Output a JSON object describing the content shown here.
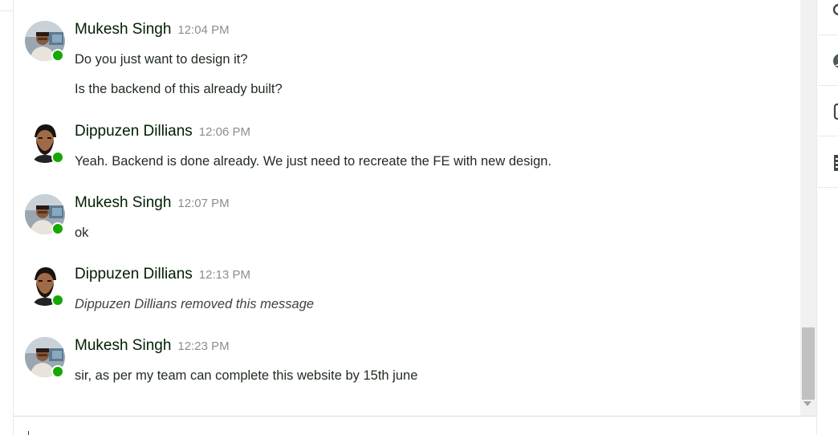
{
  "messages": [
    {
      "sender": "Mukesh Singh",
      "time": "12:04 PM",
      "avatar": "mukesh",
      "online": true,
      "lines": [
        "Do you just want to design it?",
        "Is the backend of this already built?"
      ]
    },
    {
      "sender": "Dippuzen Dillians",
      "time": "12:06 PM",
      "avatar": "dippuzen",
      "online": true,
      "lines": [
        "Yeah. Backend is done already. We just need to recreate the FE with new design."
      ]
    },
    {
      "sender": "Mukesh Singh",
      "time": "12:07 PM",
      "avatar": "mukesh",
      "online": true,
      "lines": [
        "ok"
      ]
    },
    {
      "sender": "Dippuzen Dillians",
      "time": "12:13 PM",
      "avatar": "dippuzen",
      "online": true,
      "lines": [
        "Dippuzen Dillians removed this message"
      ],
      "removed": true
    },
    {
      "sender": "Mukesh Singh",
      "time": "12:23 PM",
      "avatar": "mukesh",
      "online": true,
      "lines": [
        "sir, as per my team can complete this website by 15th june"
      ]
    }
  ],
  "right_rail": {
    "icons": [
      "search-icon",
      "profile-icon",
      "attachment-icon",
      "notes-icon"
    ]
  },
  "colors": {
    "presence": "#14a800",
    "name_text": "#001e00",
    "time_text": "#8a8f8a",
    "divider": "#e4ebe4"
  }
}
